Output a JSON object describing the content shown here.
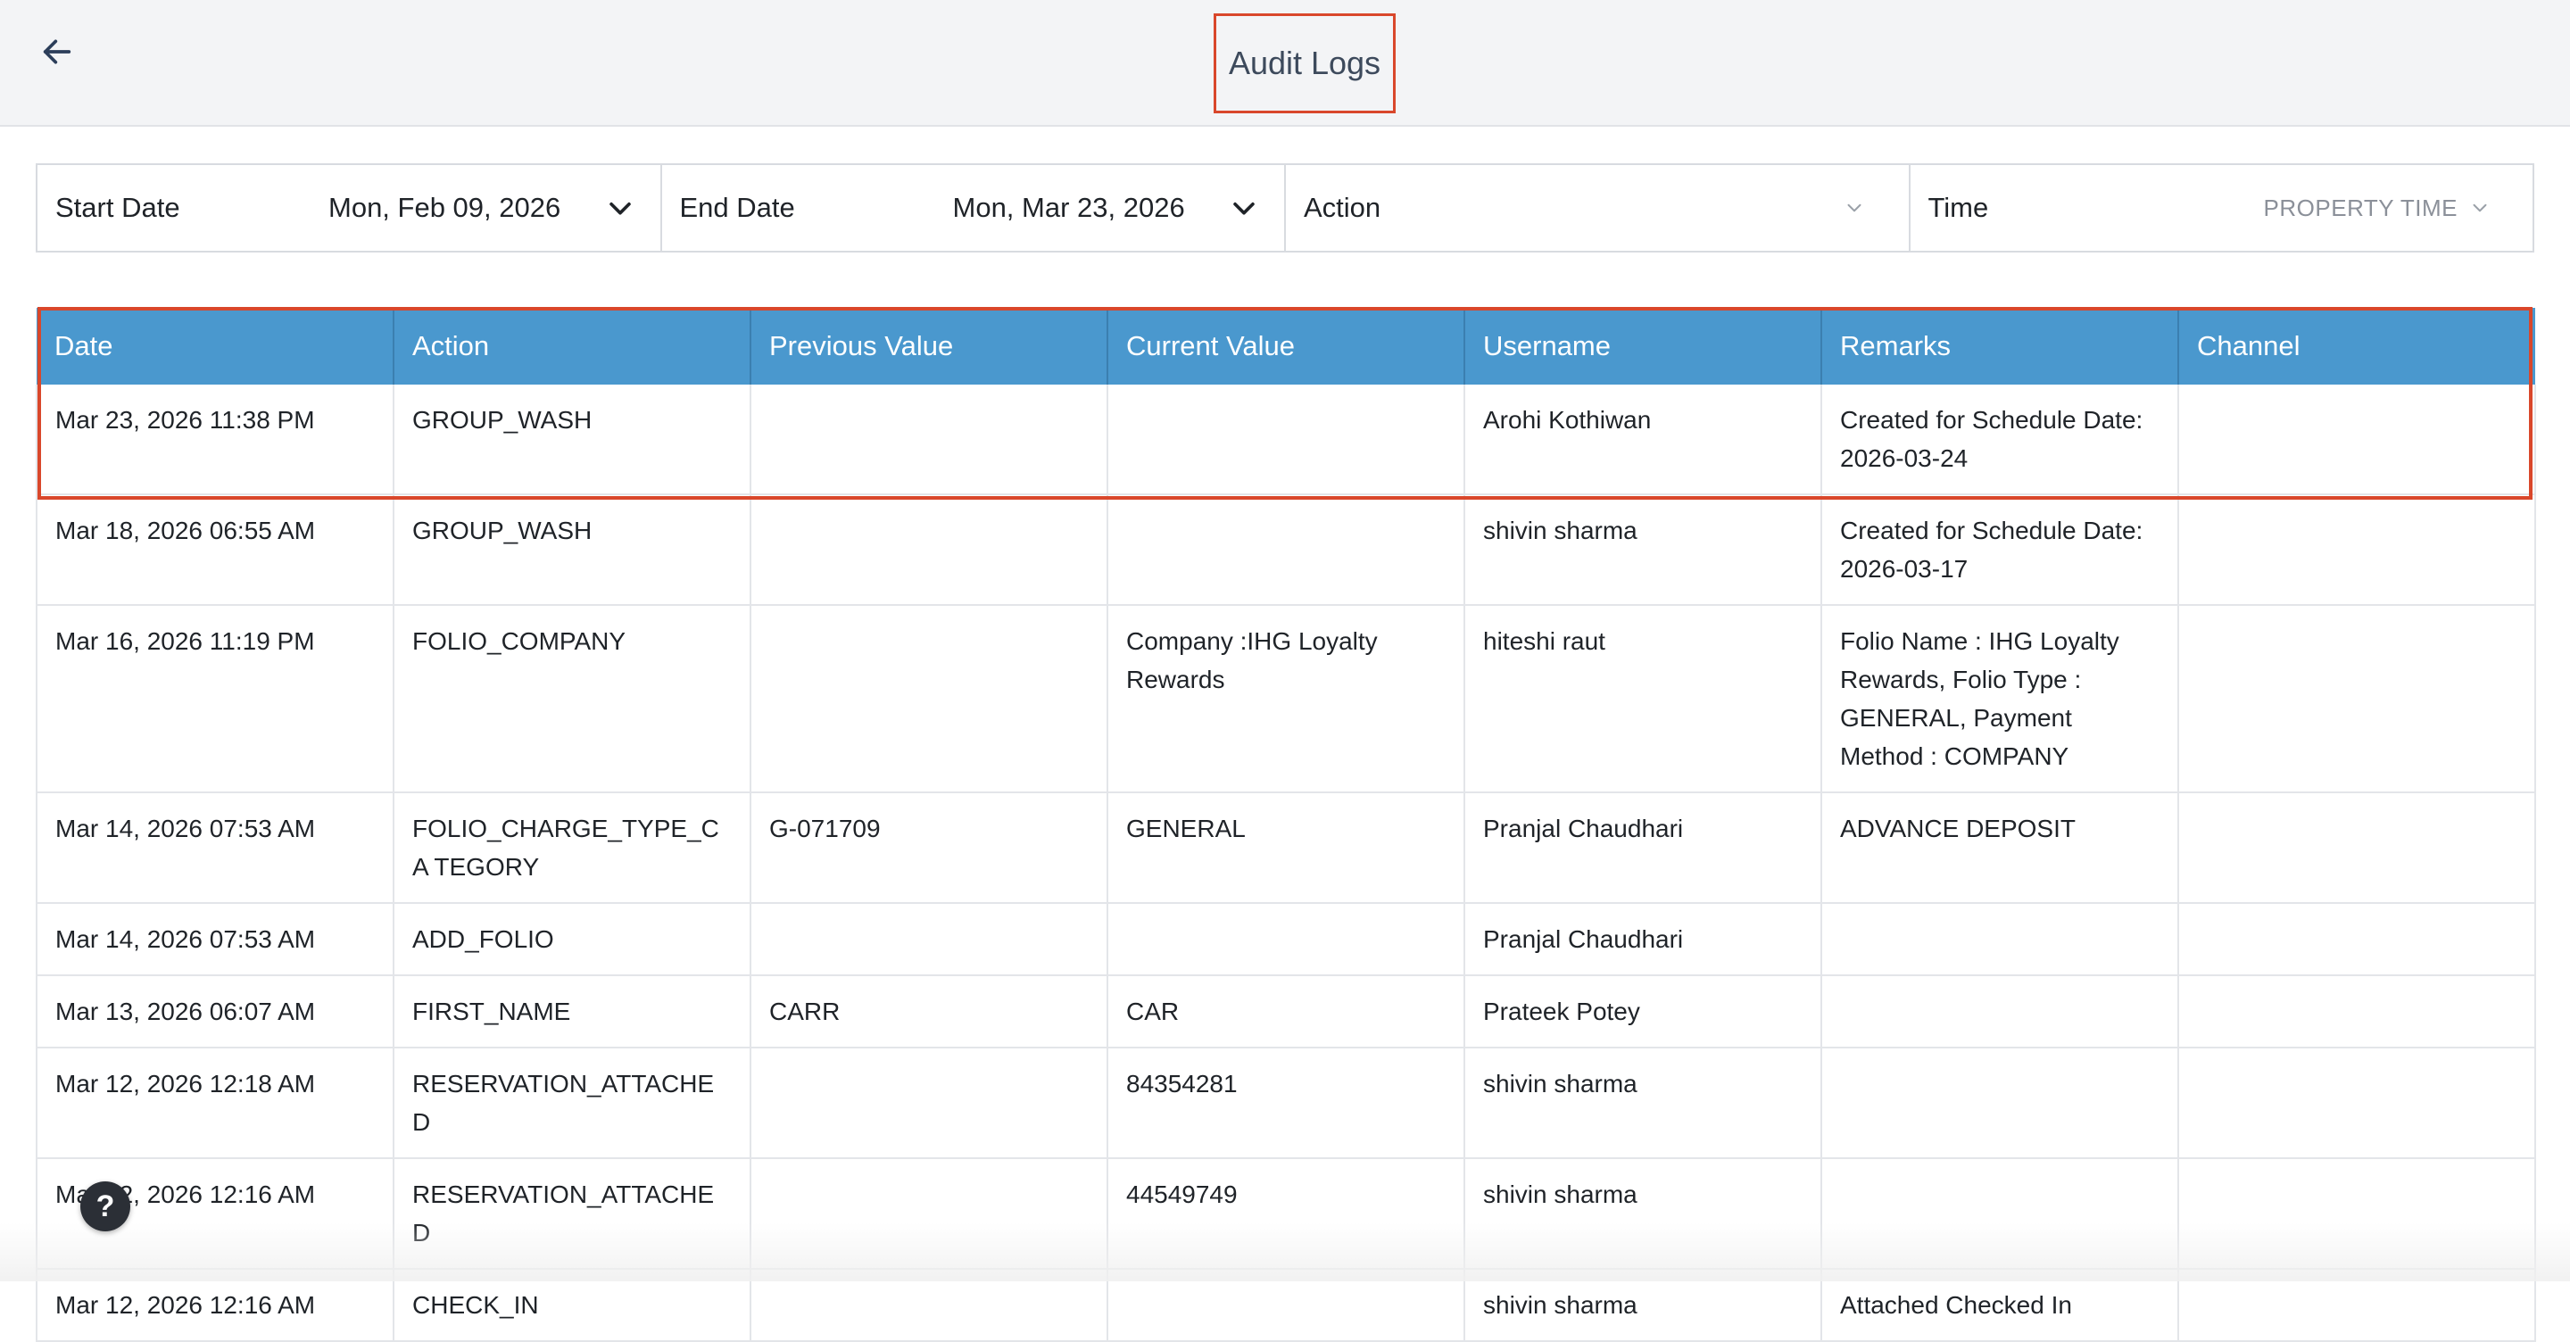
{
  "header": {
    "title": "Audit Logs",
    "back_icon": "arrow-left-icon"
  },
  "filters": {
    "start_date": {
      "label": "Start Date",
      "value": "Mon, Feb 09, 2026"
    },
    "end_date": {
      "label": "End Date",
      "value": "Mon, Mar 23, 2026"
    },
    "action": {
      "label": "Action",
      "value": ""
    },
    "time": {
      "label": "Time",
      "value": "PROPERTY TIME"
    }
  },
  "table": {
    "columns": [
      "Date",
      "Action",
      "Previous Value",
      "Current Value",
      "Username",
      "Remarks",
      "Channel"
    ],
    "rows": [
      {
        "date": "Mar 23, 2026 11:38 PM",
        "action": "GROUP_WASH",
        "previous": "",
        "current": "",
        "username": "Arohi Kothiwan",
        "remarks": "Created for Schedule Date: 2026-03-24",
        "channel": ""
      },
      {
        "date": "Mar 18, 2026 06:55 AM",
        "action": "GROUP_WASH",
        "previous": "",
        "current": "",
        "username": "shivin sharma",
        "remarks": "Created for Schedule Date: 2026-03-17",
        "channel": ""
      },
      {
        "date": "Mar 16, 2026 11:19 PM",
        "action": "FOLIO_COMPANY",
        "previous": "",
        "current": "Company :IHG Loyalty Rewards",
        "username": "hiteshi raut",
        "remarks": "Folio Name : IHG Loyalty Rewards, Folio Type : GENERAL, Payment Method : COMPANY",
        "channel": ""
      },
      {
        "date": "Mar 14, 2026 07:53 AM",
        "action": "FOLIO_CHARGE_TYPE_CA TEGORY",
        "previous": "G-071709",
        "current": "GENERAL",
        "username": "Pranjal Chaudhari",
        "remarks": "ADVANCE DEPOSIT",
        "channel": ""
      },
      {
        "date": "Mar 14, 2026 07:53 AM",
        "action": "ADD_FOLIO",
        "previous": "",
        "current": "",
        "username": "Pranjal Chaudhari",
        "remarks": "",
        "channel": ""
      },
      {
        "date": "Mar 13, 2026 06:07 AM",
        "action": "FIRST_NAME",
        "previous": "CARR",
        "current": "CAR",
        "username": "Prateek Potey",
        "remarks": "",
        "channel": ""
      },
      {
        "date": "Mar 12, 2026 12:18 AM",
        "action": "RESERVATION_ATTACHED",
        "previous": "",
        "current": "84354281",
        "username": "shivin sharma",
        "remarks": "",
        "channel": ""
      },
      {
        "date": "Mar 12, 2026 12:16 AM",
        "action": "RESERVATION_ATTACHED",
        "previous": "",
        "current": "44549749",
        "username": "shivin sharma",
        "remarks": "",
        "channel": ""
      },
      {
        "date": "Mar 12, 2026 12:16 AM",
        "action": "CHECK_IN",
        "previous": "",
        "current": "",
        "username": "shivin sharma",
        "remarks": "Attached Checked In",
        "channel": ""
      }
    ]
  },
  "help": {
    "label": "?"
  }
}
